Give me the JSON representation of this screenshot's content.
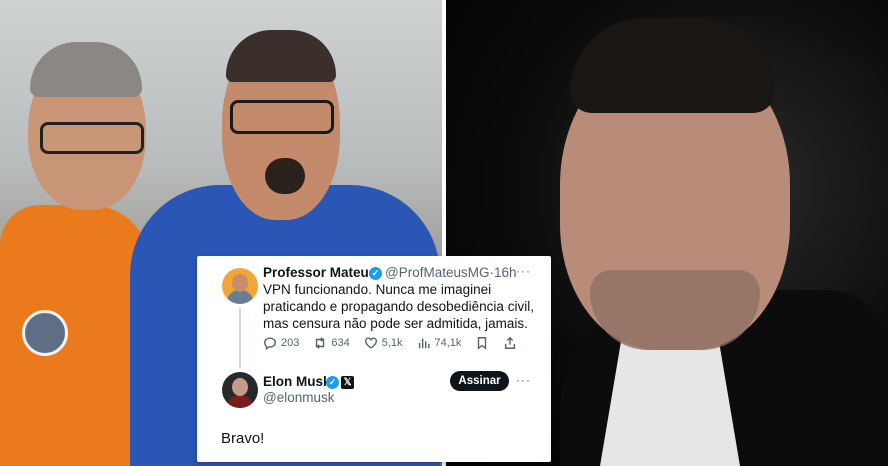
{
  "tweet": {
    "author_name": "Professor Mateus",
    "author_handle": "@ProfMateusMG",
    "time_sep": "·",
    "time": "16h",
    "more": "···",
    "text_lines": [
      "VPN funcionando. Nunca me imaginei",
      "praticando e propagando desobediência civil,",
      "mas censura não pode ser admitida, jamais."
    ],
    "stats": {
      "replies": "203",
      "retweets": "634",
      "likes": "5,1k",
      "views": "74,1k"
    }
  },
  "reply": {
    "author_name": "Elon Musk",
    "author_handle": "@elonmusk",
    "follow_label": "Assinar",
    "more": "···",
    "text": "Bravo!"
  },
  "icons": {
    "verified": "verified-check-icon",
    "x_badge": "x-logo-icon",
    "reply": "reply-icon",
    "retweet": "retweet-icon",
    "like": "heart-icon",
    "views": "bar-chart-icon",
    "bookmark": "bookmark-icon",
    "share": "share-icon"
  },
  "colors": {
    "verified_blue": "#1d9bf0",
    "text_primary": "#0f1419",
    "text_secondary": "#536471",
    "left_shirt_orange": "#ea7a1c",
    "right_shirt_blue": "#2a56b6"
  }
}
